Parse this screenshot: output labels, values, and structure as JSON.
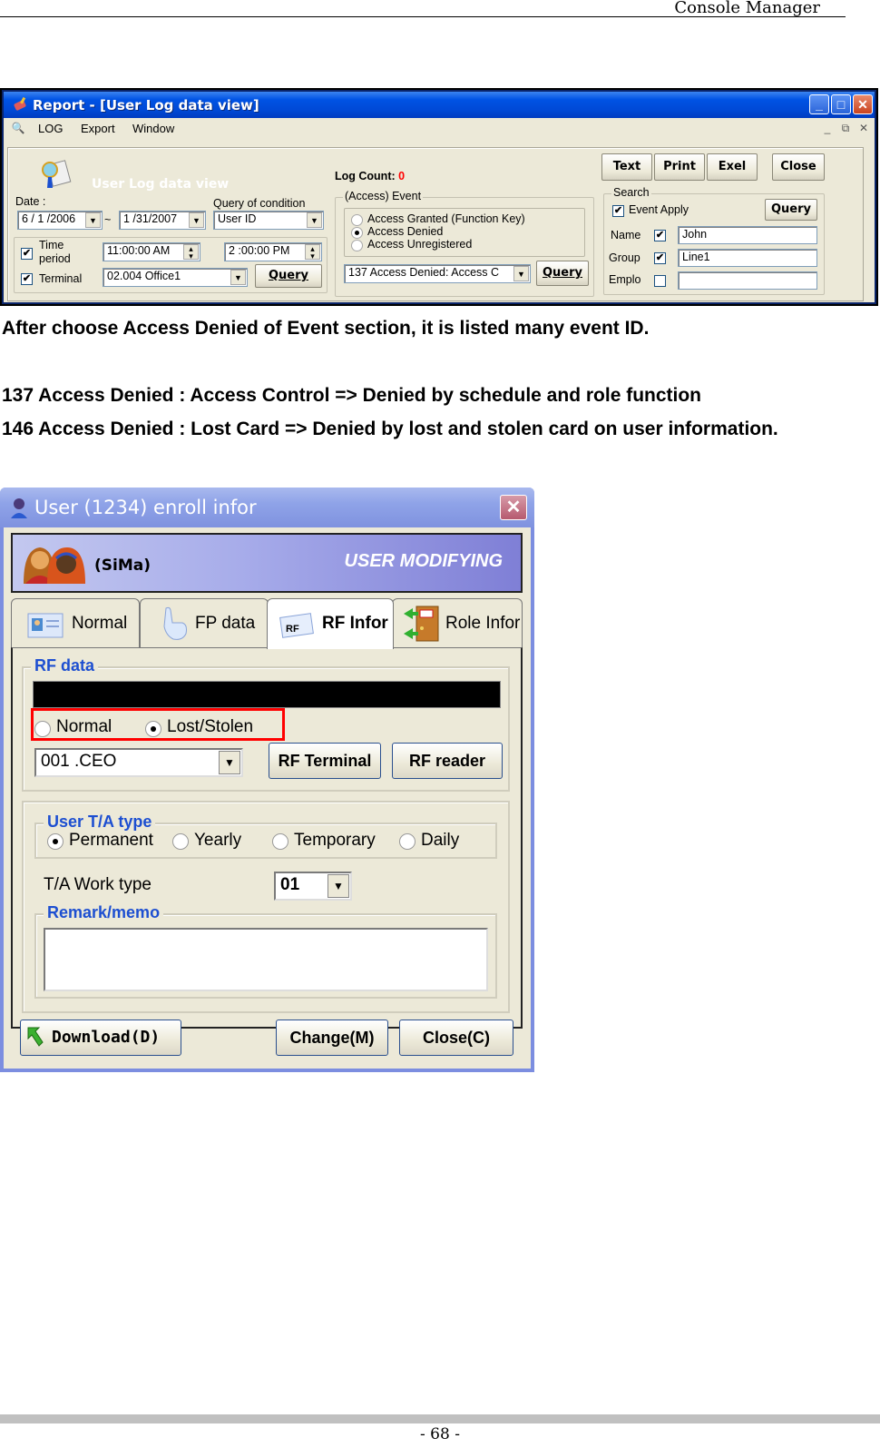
{
  "page": {
    "header_title": "Console Manager",
    "page_number": "- 68 -"
  },
  "report_window": {
    "title": "Report - [User Log data view]",
    "menu": [
      "LOG",
      "Export",
      "Window"
    ],
    "banner_title": "User Log data view",
    "log_count_label": "Log Count:",
    "log_count_value": "0",
    "log_count_color": "#ff0000",
    "date_label": "Date :",
    "date_from": "6 / 1 /2006",
    "date_sep": "~",
    "date_to": "1 /31/2007",
    "query_condition_label": "Query of condition",
    "query_condition_value": "User ID",
    "time_period_label": "Time period",
    "time_period_checked": true,
    "time_from": "11:00:00 AM",
    "time_to": "2 :00:00 PM",
    "terminal_label": "Terminal",
    "terminal_checked": true,
    "terminal_value": "02.004 Office1",
    "query_label": "Query",
    "event_group_label": "(Access) Event",
    "event_options": [
      {
        "label": "Access Granted (Function Key)",
        "selected": false
      },
      {
        "label": "Access Denied",
        "selected": true
      },
      {
        "label": "Access Unregistered",
        "selected": false
      }
    ],
    "event_id_value": "137 Access Denied: Access C",
    "buttons": {
      "text": "Text",
      "print": "Print",
      "exel": "Exel",
      "close": "Close"
    },
    "search": {
      "label": "Search",
      "event_apply_label": "Event Apply",
      "event_apply_checked": true,
      "query_label": "Query",
      "name_label": "Name",
      "name_checked": true,
      "name_value": "John",
      "group_label": "Group",
      "group_checked": true,
      "group_value": "Line1",
      "emplo_label": "Emplo",
      "emplo_checked": false,
      "emplo_value": ""
    }
  },
  "text": {
    "para1": "After choose Access Denied of Event section, it is listed many event ID.",
    "para2_line1": "137 Access Denied : Access Control => Denied by schedule and role function",
    "para2_line2": "146 Access Denied : Lost Card => Denied by lost and stolen card on user information."
  },
  "enroll_dialog": {
    "title": "User (1234) enroll infor",
    "user_name": "(SiMa)",
    "mode": "USER MODIFYING",
    "tabs": [
      {
        "label": "Normal",
        "active": false
      },
      {
        "label": "FP data",
        "active": false
      },
      {
        "label": "RF Infor",
        "active": true
      },
      {
        "label": "Role Infor",
        "active": false
      }
    ],
    "rf_data_label": "RF data",
    "rf_status_options": [
      {
        "label": "Normal",
        "selected": false
      },
      {
        "label": "Lost/Stolen",
        "selected": true
      }
    ],
    "rf_select_value": "001 .CEO",
    "rf_terminal_label": "RF Terminal",
    "rf_reader_label": "RF reader",
    "ta_type_label": "User T/A type",
    "ta_type_options": [
      {
        "label": "Permanent",
        "selected": true
      },
      {
        "label": "Yearly",
        "selected": false
      },
      {
        "label": "Temporary",
        "selected": false
      },
      {
        "label": "Daily",
        "selected": false
      }
    ],
    "ta_work_type_label": "T/A Work type",
    "ta_work_type_value": "01",
    "remark_label": "Remark/memo",
    "remark_value": "",
    "download_label": "Download(D)",
    "change_label": "Change(M)",
    "close_label": "Close(C)",
    "highlight_color": "#ff0000"
  }
}
